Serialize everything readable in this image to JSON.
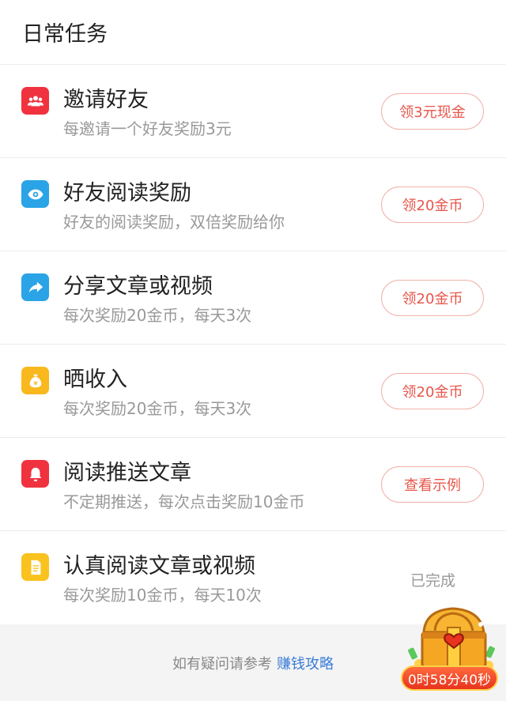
{
  "header": {
    "title": "日常任务"
  },
  "tasks": [
    {
      "name": "邀请好友",
      "desc": "每邀请一个好友奖励3元",
      "action": "领3元现金",
      "icon": "users-icon",
      "color": "#f0323f"
    },
    {
      "name": "好友阅读奖励",
      "desc": "好友的阅读奖励，双倍奖励给你",
      "action": "领20金币",
      "icon": "eye-icon",
      "color": "#2aa4e6"
    },
    {
      "name": "分享文章或视频",
      "desc": "每次奖励20金币，每天3次",
      "action": "领20金币",
      "icon": "share-arrow-icon",
      "color": "#2aa4e6"
    },
    {
      "name": "晒收入",
      "desc": "每次奖励20金币，每天3次",
      "action": "领20金币",
      "icon": "money-bag-icon",
      "color": "#f9b81e"
    },
    {
      "name": "阅读推送文章",
      "desc": "不定期推送，每次点击奖励10金币",
      "action": "查看示例",
      "icon": "bell-icon",
      "color": "#f0323f"
    },
    {
      "name": "认真阅读文章或视频",
      "desc": "每次奖励10金币，每天10次",
      "status": "已完成",
      "icon": "document-icon",
      "color": "#f9c21e"
    }
  ],
  "footer": {
    "prefix": "如有疑问请参考",
    "link": "赚钱攻略"
  },
  "chest": {
    "icon": "treasure-chest-icon",
    "timer": "0时58分40秒"
  }
}
